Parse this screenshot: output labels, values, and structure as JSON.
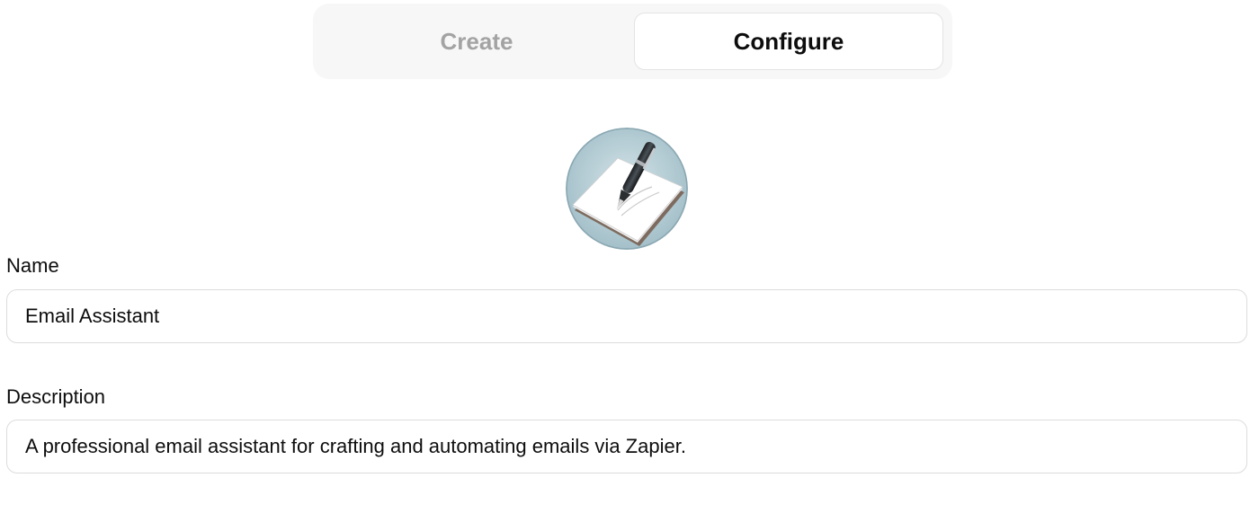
{
  "tabs": {
    "create_label": "Create",
    "configure_label": "Configure",
    "active": "Configure"
  },
  "avatar": {
    "icon": "notepad-pen-icon"
  },
  "name_field": {
    "label": "Name",
    "value": "Email Assistant"
  },
  "description_field": {
    "label": "Description",
    "value": "A professional email assistant for crafting and automating emails via Zapier."
  }
}
